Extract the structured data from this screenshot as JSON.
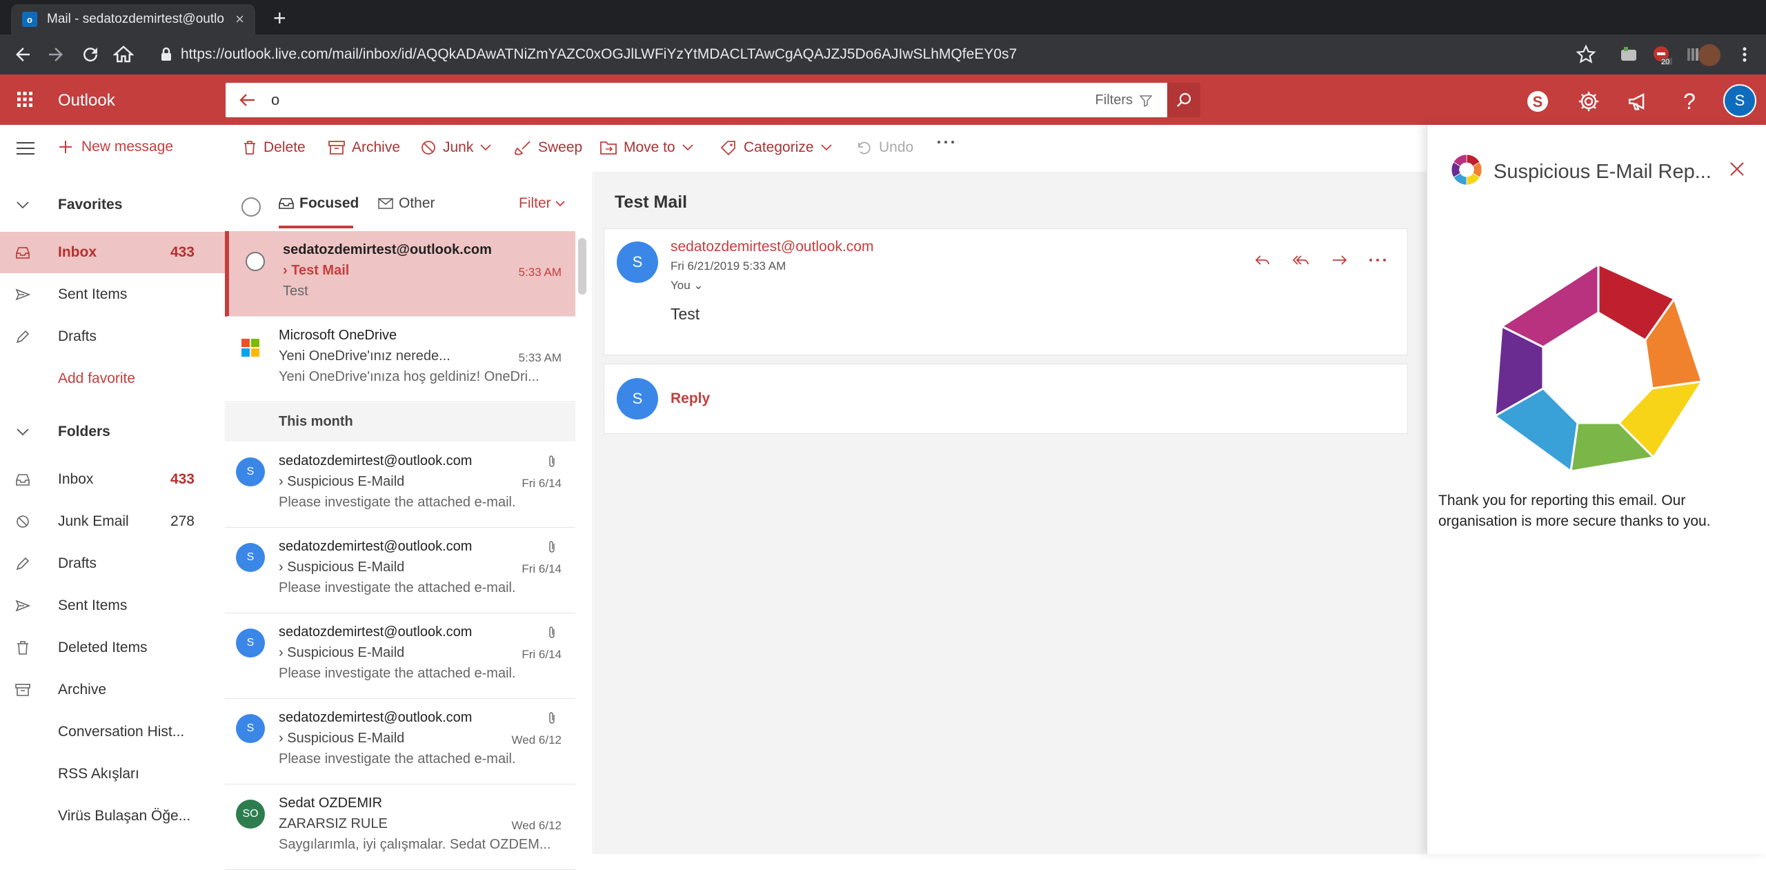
{
  "browser": {
    "tab_title": "Mail - sedatozdemirtest@outlo",
    "url": "https://outlook.live.com/mail/inbox/id/AQQkADAwATNiZmYAZC0xOGJlLWFiYzYtMDACLTAwCgAQAJZJ5Do6AJIwSLhMQfeEY0s7",
    "ext_badge": "20"
  },
  "outlook": {
    "brand": "Outlook",
    "search_query": "o",
    "filters_label": "Filters",
    "avatar_letter": "S",
    "accent": "#c43e3e"
  },
  "commands": {
    "new_message": "New message",
    "delete": "Delete",
    "archive": "Archive",
    "junk": "Junk",
    "sweep": "Sweep",
    "move_to": "Move to",
    "categorize": "Categorize",
    "undo": "Undo"
  },
  "nav": {
    "favorites": "Favorites",
    "fav_items": [
      {
        "label": "Inbox",
        "count": "433"
      },
      {
        "label": "Sent Items",
        "count": ""
      },
      {
        "label": "Drafts",
        "count": ""
      }
    ],
    "add_favorite": "Add favorite",
    "folders": "Folders",
    "folder_items": [
      {
        "label": "Inbox",
        "count": "433"
      },
      {
        "label": "Junk Email",
        "count": "278"
      },
      {
        "label": "Drafts",
        "count": ""
      },
      {
        "label": "Sent Items",
        "count": ""
      },
      {
        "label": "Deleted Items",
        "count": ""
      },
      {
        "label": "Archive",
        "count": ""
      },
      {
        "label": "Conversation Hist...",
        "count": ""
      },
      {
        "label": "RSS Akışları",
        "count": ""
      },
      {
        "label": "Virüs Bulaşan Öğe...",
        "count": ""
      }
    ]
  },
  "list": {
    "tab_focused": "Focused",
    "tab_other": "Other",
    "filter": "Filter",
    "section_month": "This month",
    "messages": [
      {
        "from": "sedatozdemirtest@outlook.com",
        "subject": "Test Mail",
        "time": "5:33 AM",
        "preview": "Test"
      },
      {
        "from": "Microsoft OneDrive",
        "subject": "Yeni OneDrive'ınız nerede...",
        "time": "5:33 AM",
        "preview": "Yeni OneDrive'ınıza hoş geldiniz! OneDri..."
      },
      {
        "avatar": "S",
        "from": "sedatozdemirtest@outlook.com",
        "subject": "Suspicious E-Maild",
        "time": "Fri 6/14",
        "preview": "Please investigate the attached e-mail."
      },
      {
        "avatar": "S",
        "from": "sedatozdemirtest@outlook.com",
        "subject": "Suspicious E-Maild",
        "time": "Fri 6/14",
        "preview": "Please investigate the attached e-mail."
      },
      {
        "avatar": "S",
        "from": "sedatozdemirtest@outlook.com",
        "subject": "Suspicious E-Maild",
        "time": "Fri 6/14",
        "preview": "Please investigate the attached e-mail."
      },
      {
        "avatar": "S",
        "from": "sedatozdemirtest@outlook.com",
        "subject": "Suspicious E-Maild",
        "time": "Wed 6/12",
        "preview": "Please investigate the attached e-mail."
      },
      {
        "avatar": "SO",
        "from": "Sedat OZDEMIR",
        "subject": "ZARARSIZ RULE",
        "time": "Wed 6/12",
        "preview": "Saygılarımla, iyi çalışmalar. Sedat OZDEM..."
      }
    ]
  },
  "reading": {
    "subject": "Test Mail",
    "avatar": "S",
    "from": "sedatozdemirtest@outlook.com",
    "date": "Fri 6/21/2019 5:33 AM",
    "to": "You",
    "body": "Test",
    "reply_label": "Reply"
  },
  "addin": {
    "title": "Suspicious E-Mail Rep...",
    "message": "Thank you for reporting this email. Our organisation is more secure thanks to you."
  }
}
